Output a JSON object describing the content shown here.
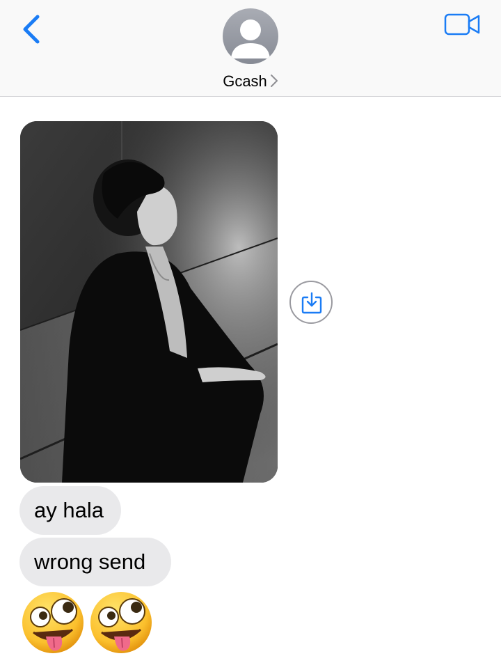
{
  "header": {
    "contact_name": "Gcash",
    "back_icon": "chevron-left-icon",
    "video_icon": "video-camera-icon",
    "avatar_icon": "person-silhouette-icon",
    "accent_color": "#1a7cf5"
  },
  "messages": {
    "photo": {
      "icon": "photo-attachment",
      "save_icon": "download-icon"
    },
    "texts": [
      {
        "text": "ay hala"
      },
      {
        "text": "wrong send"
      }
    ],
    "emoji": [
      "🤪",
      "🤪"
    ]
  }
}
